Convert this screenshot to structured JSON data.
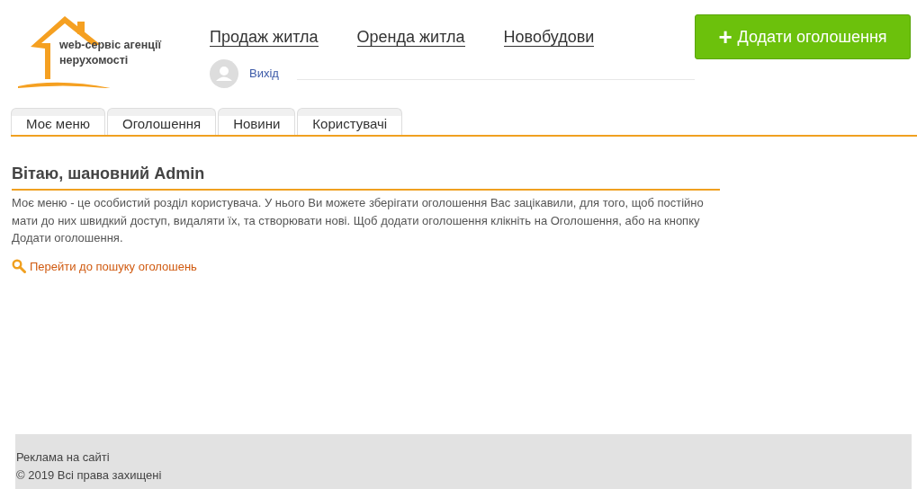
{
  "logo": {
    "text": "web-сервіс агенції нерухомості"
  },
  "nav": [
    "Продаж житла",
    "Оренда житла",
    "Новобудови"
  ],
  "add_button": {
    "icon": "+",
    "label": "Додати оголошення"
  },
  "user": {
    "logout": "Вихід"
  },
  "tabs": [
    {
      "label": "Моє меню"
    },
    {
      "label": "Оголошення"
    },
    {
      "label": "Новини"
    },
    {
      "label": "Користувачі"
    }
  ],
  "content": {
    "heading": "Вітаю, шановний Admin",
    "text": "Моє меню - це особистий розділ користувача. У нього Ви можете зберігати оголошення Вас зацікавили, для того, щоб постійно мати до них швидкий доступ, видаляти їх, та створювати нові. Щоб додати оголошення   клікніть на Оголошення, або на кнопку Додати оголошення.",
    "search_link": "Перейти до пошуку оголошень"
  },
  "footer": {
    "ads": "Реклама на сайті",
    "copyright": "© 2019 Всі права захищені"
  }
}
